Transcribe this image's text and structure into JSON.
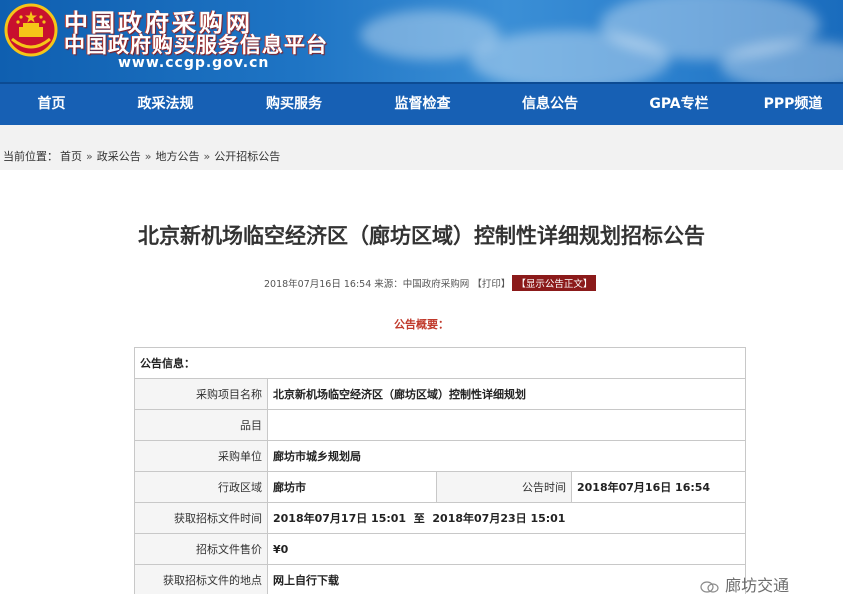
{
  "banner": {
    "title_line1": "中国政府采购网",
    "title_line2": "中国政府购买服务信息平台",
    "url": "www.ccgp.gov.cn",
    "emblem_icon": "national-emblem-icon"
  },
  "nav": {
    "items": [
      {
        "label": "首页"
      },
      {
        "label": "政采法规"
      },
      {
        "label": "购买服务"
      },
      {
        "label": "监督检查"
      },
      {
        "label": "信息公告"
      },
      {
        "label": "GPA专栏"
      },
      {
        "label": "PPP频道"
      }
    ]
  },
  "breadcrumb": {
    "prefix": "当前位置：",
    "items": [
      "首页",
      "政采公告",
      "地方公告",
      "公开招标公告"
    ],
    "separator": "»"
  },
  "article": {
    "title": "北京新机场临空经济区（廊坊区域）控制性详细规划招标公告",
    "meta_date": "2018年07月16日 16:54",
    "meta_source": "来源：中国政府采购网",
    "meta_print": "【打印】",
    "meta_show_body": "【显示公告正文】",
    "summary_heading": "公告概要："
  },
  "table": {
    "section_header": "公告信息：",
    "project_name_label": "采购项目名称",
    "project_name_value": "北京新机场临空经济区（廊坊区域）控制性详细规划",
    "item_label": "品目",
    "item_value": "",
    "buyer_label": "采购单位",
    "buyer_value": "廊坊市城乡规划局",
    "region_label": "行政区域",
    "region_value": "廊坊市",
    "publish_time_label": "公告时间",
    "publish_time_value": "2018年07月16日 16:54",
    "doc_period_label": "获取招标文件时间",
    "doc_period_value": "2018年07月17日 15:01  至  2018年07月23日 15:01",
    "doc_price_label": "招标文件售价",
    "doc_price_value": "¥0",
    "doc_place_label": "获取招标文件的地点",
    "doc_place_value": "网上自行下载"
  },
  "watermark": {
    "text": "廊坊交通",
    "icon": "wechat-icon"
  },
  "colors": {
    "nav_bg": "#1760b4",
    "accent_red": "#c0392b",
    "show_btn_bg": "#8b1a1a"
  }
}
